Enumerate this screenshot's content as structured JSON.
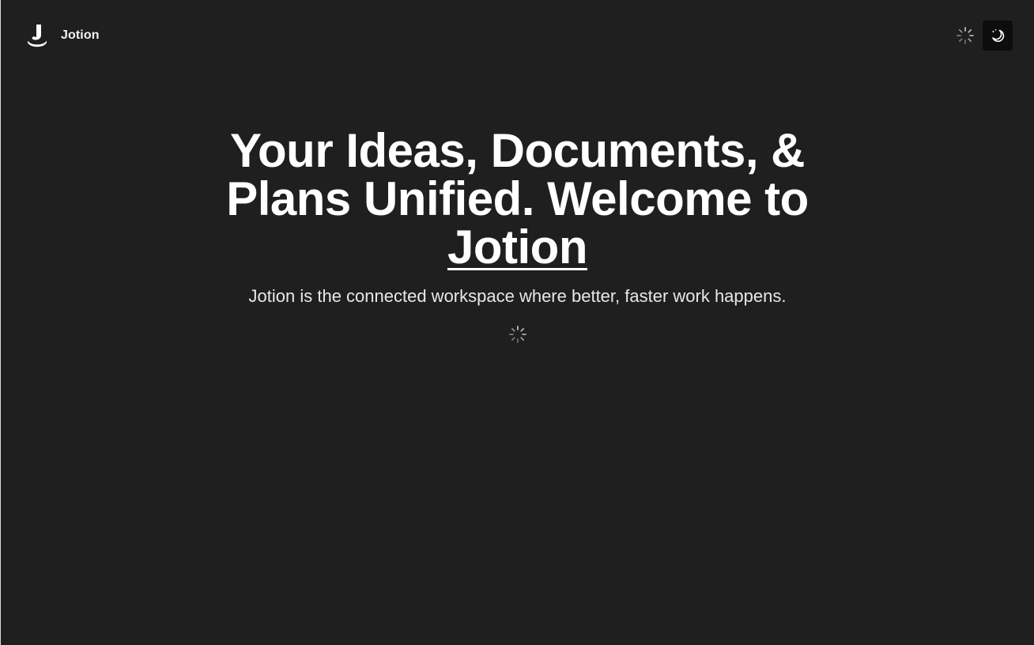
{
  "navbar": {
    "brand_name": "Jotion",
    "logo_icon": "jotion-logo-icon",
    "loading_icon": "loading-spinner-icon",
    "theme_toggle_icon": "moon-icon"
  },
  "hero": {
    "headline_main": "Your Ideas, Documents, & Plans Unified. Welcome to",
    "headline_brand": "Jotion",
    "subheadline": "Jotion is the connected workspace where better, faster work happens.",
    "loading_icon": "loading-spinner-icon"
  },
  "colors": {
    "background": "#1f1f1f",
    "text": "#ffffff",
    "toggle_background": "#0d0d0d"
  }
}
